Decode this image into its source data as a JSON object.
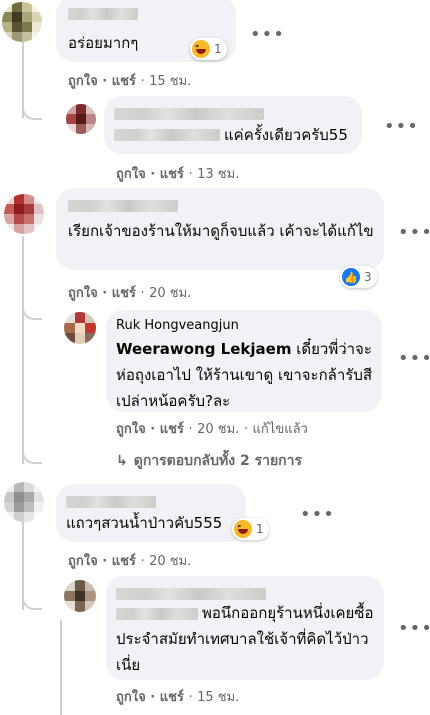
{
  "comments": [
    {
      "text": "อร่อยมากๆ",
      "reaction_count": "1",
      "reaction_icon": "haha-icon",
      "like": "ถูกใจ",
      "reply": "แชร์",
      "time": "15 ชม."
    },
    {
      "text": "แค่ครั้งเดียวครับ55",
      "like": "ถูกใจ",
      "reply": "แชร์",
      "time": "13 ชม."
    },
    {
      "text": "เรียกเจ้าของร้านให้มาดูก็จบแล้ว เค้าจะได้แก้ไข",
      "reaction_count": "3",
      "reaction_icon": "like-icon",
      "like": "ถูกใจ",
      "reply": "แชร์",
      "time": "20 ชม."
    },
    {
      "author": "Ruk Hongveangjun",
      "mention": "Weerawong Lekjaem",
      "text": "เดี๋ยวพี่ว่าจะห่อถุงเอาไป ให้ร้านเขาดู เขาจะกล้ารับสีเปล่าหน้อครับ?ละ",
      "like": "ถูกใจ",
      "reply": "แชร์",
      "time": "20 ชม.",
      "edited": "แก้ไขแล้ว"
    },
    {
      "view_replies": "ดูการตอบกลับทั้ง 2 รายการ"
    },
    {
      "text": "แถวๆสวนน้ำป่าวคับ555",
      "reaction_count": "1",
      "reaction_icon": "haha-icon",
      "like": "ถูกใจ",
      "reply": "แชร์",
      "time": "20 ชม."
    },
    {
      "text": "พอนึกออกยุร้านหนึ่งเคยซื้อประจำสมัยทำเทศบาลใช้เจ้าที่คิดไว้ป่าวเนี่ย",
      "like": "ถูกใจ",
      "reply": "แชร์",
      "time": "15 ชม."
    }
  ],
  "separator": "·",
  "more_icon": "more-options-icon",
  "reply_arrow_icon": "reply-arrow-icon"
}
